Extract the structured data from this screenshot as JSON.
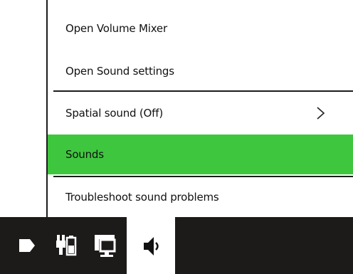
{
  "menu": {
    "items": [
      {
        "label": "Open Volume Mixer"
      },
      {
        "label": "Open Sound settings"
      },
      {
        "label": "Spatial sound (Off)",
        "has_submenu": true
      },
      {
        "label": "Sounds",
        "highlighted": true
      },
      {
        "label": "Troubleshoot sound problems"
      }
    ],
    "highlight_color": "#3fc63f"
  },
  "taskbar": {
    "background": "#1d1a1a",
    "tray_icons": [
      "flag-icon",
      "power-plug-icon",
      "network-icon",
      "speaker-icon"
    ],
    "active_icon": "speaker-icon"
  }
}
